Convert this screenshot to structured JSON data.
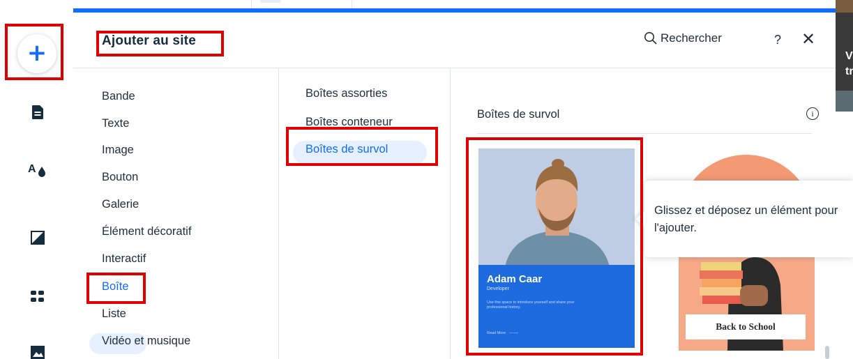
{
  "toolbar": {
    "add_icon": "plus-icon",
    "icons": [
      "pages-icon",
      "theme-icon",
      "background-icon",
      "apps-icon",
      "media-icon"
    ]
  },
  "panel": {
    "title": "Ajouter au site",
    "search_label": "Rechercher",
    "help_label": "?",
    "close_label": "✕"
  },
  "categories": {
    "items": [
      "Bande",
      "Texte",
      "Image",
      "Bouton",
      "Galerie",
      "Élément décoratif",
      "Interactif",
      "Boîte",
      "Liste",
      "Vidéo et musique"
    ],
    "selected": "Boîte"
  },
  "subcategories": {
    "items": [
      "Boîtes assorties",
      "Boîtes conteneur",
      "Boîtes de survol"
    ],
    "selected": "Boîtes de survol"
  },
  "section": {
    "title": "Boîtes de survol",
    "info_label": "i"
  },
  "cards": {
    "profile": {
      "name": "Adam Caar",
      "role": "Developer",
      "description": "Use this space to introduce yourself and share your professional history.",
      "link": "Read More"
    },
    "school": {
      "label": "Back to School"
    }
  },
  "tooltip": {
    "text": "Glissez et déposez un élément pour l'ajouter."
  },
  "right_edge": {
    "fragment": "V\ntre"
  },
  "colors": {
    "accent": "#116dff",
    "highlight": "#e7f0ff",
    "annotation": "#e00000",
    "card_blue": "#1e6be0",
    "card_peach": "#f7a887"
  }
}
